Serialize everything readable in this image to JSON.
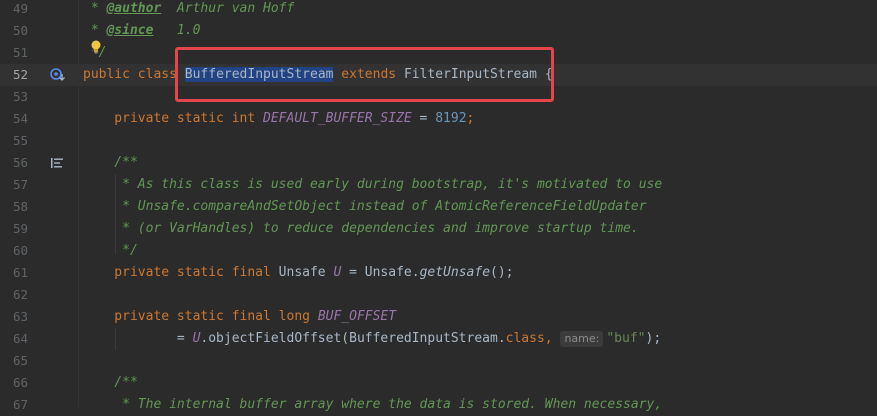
{
  "lines": [
    {
      "num": "49"
    },
    {
      "num": "50"
    },
    {
      "num": "51"
    },
    {
      "num": "52"
    },
    {
      "num": "53"
    },
    {
      "num": "54"
    },
    {
      "num": "55"
    },
    {
      "num": "56"
    },
    {
      "num": "57"
    },
    {
      "num": "58"
    },
    {
      "num": "59"
    },
    {
      "num": "60"
    },
    {
      "num": "61"
    },
    {
      "num": "62"
    },
    {
      "num": "63"
    },
    {
      "num": "64"
    },
    {
      "num": "65"
    },
    {
      "num": "66"
    },
    {
      "num": "67"
    }
  ],
  "code": {
    "l49_star": " * ",
    "l49_tag": "@author",
    "l49_text": "  Arthur van Hoff",
    "l50_star": " * ",
    "l50_tag": "@since",
    "l50_text": "   1.0",
    "l51": " */",
    "l52_public": "public",
    "l52_class": " class ",
    "l52_name": "BufferedInputStream",
    "l52_extends": " extends ",
    "l52_super": "FilterInputStream",
    "l52_brace": " {",
    "l54_mods": "    private static int ",
    "l54_field": "DEFAULT_BUFFER_SIZE",
    "l54_eq": " = ",
    "l54_num": "8192",
    "l54_semi": ";",
    "l56": "    /**",
    "l57": "     * As this class is used early during bootstrap, it's motivated to use",
    "l58": "     * Unsafe.compareAndSetObject instead of AtomicReferenceFieldUpdater",
    "l59": "     * (or VarHandles) to reduce dependencies and improve startup time.",
    "l60": "     */",
    "l61_mods": "    private static final ",
    "l61_type": "Unsafe ",
    "l61_field": "U",
    "l61_eq": " = Unsafe.",
    "l61_call": "getUnsafe",
    "l61_end": "();",
    "l63_mods": "    private static final long ",
    "l63_field": "BUF_OFFSET",
    "l64_eq": "            = ",
    "l64_u": "U",
    "l64_call": ".objectFieldOffset(BufferedInputStream.",
    "l64_class": "class",
    "l64_comma": ", ",
    "l64_hint": "name:",
    "l64_str": "\"buf\"",
    "l64_end": ");",
    "l66": "    /**",
    "l67": "     * The internal buffer array where the data is stored. When necessary,"
  },
  "icons": {
    "bulb": "lightbulb-icon",
    "override": "implemented-icon",
    "doc": "javadoc-toggle-icon"
  },
  "colors": {
    "background": "#2b2b2b",
    "keyword": "#cc7832",
    "comment": "#629755",
    "number": "#6897bb",
    "string": "#6a8759",
    "static_field": "#9876aa",
    "selection": "#214283",
    "highlight_box": "#e4454a"
  }
}
